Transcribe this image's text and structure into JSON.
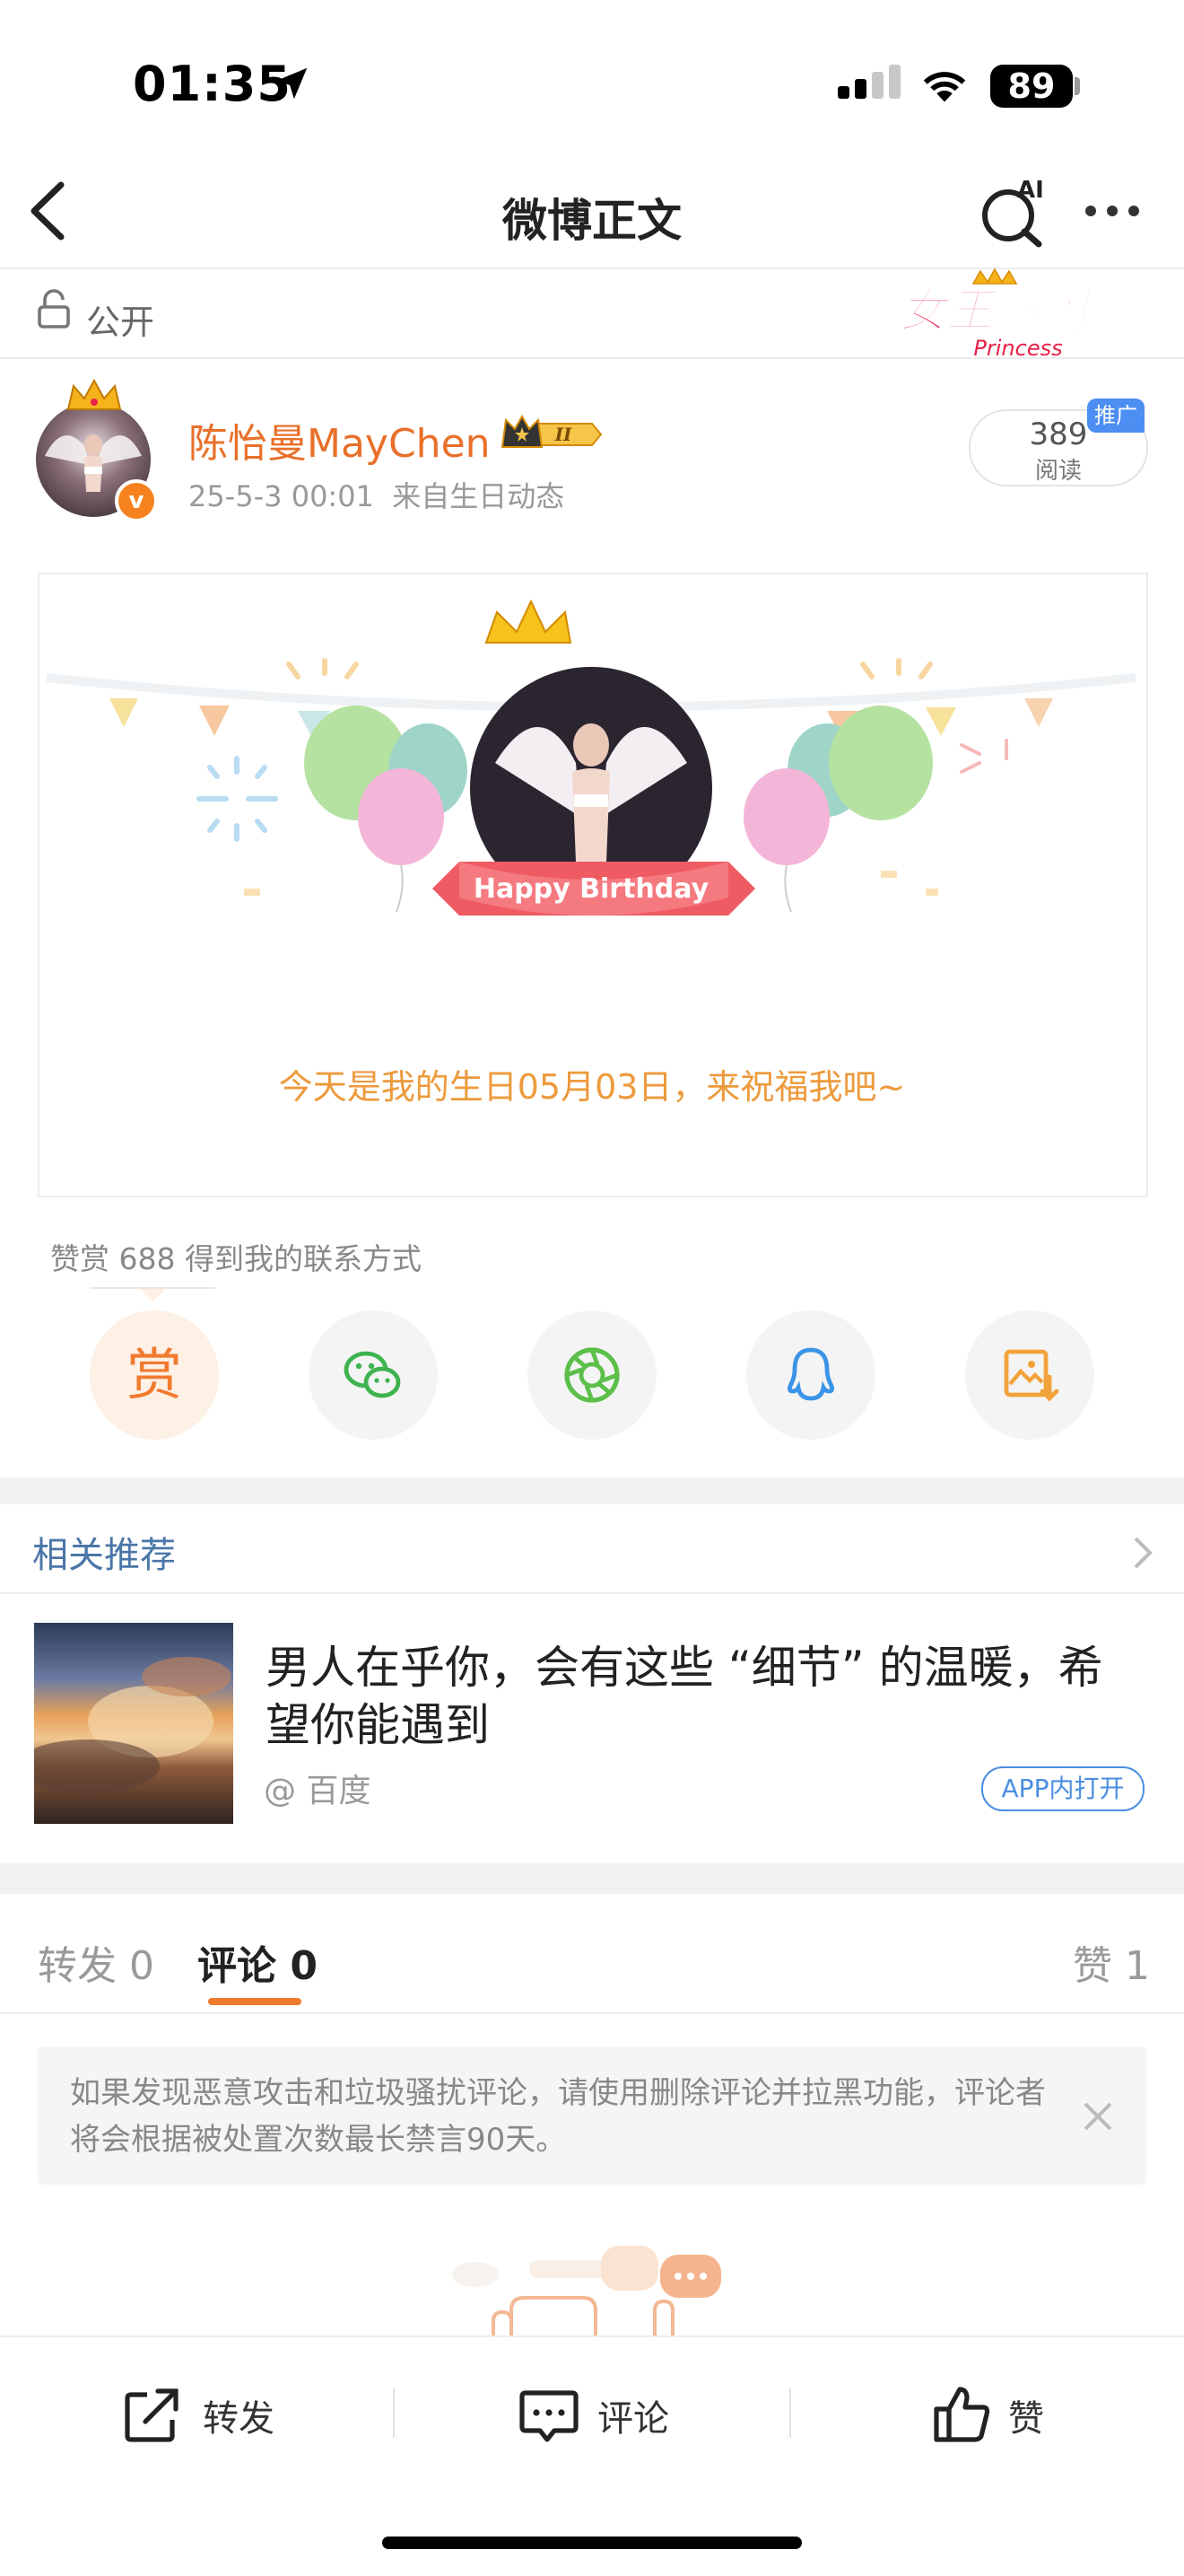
{
  "status": {
    "time": "01:35",
    "battery": "89"
  },
  "nav": {
    "title": "微博正文",
    "ai_label": "AI"
  },
  "visibility": {
    "label": "公开"
  },
  "badge": {
    "signin_text": "女王驾到",
    "signin_sub": "Princess"
  },
  "author": {
    "name": "陈怡曼MayChen",
    "vip_level": "II",
    "timestamp": "25-5-3 00:01",
    "source": "来自生日动态"
  },
  "reads": {
    "count": "389",
    "label": "阅读",
    "promo_tag": "推广"
  },
  "birthday": {
    "banner": "Happy Birthday",
    "message": "今天是我的生日05月03日，来祝福我吧~"
  },
  "reward_tip": "赞赏 688 得到我的联系方式",
  "share": {
    "reward_char": "赏"
  },
  "related": {
    "title": "相关推荐",
    "headline": "男人在乎你，会有这些 “细节” 的温暖，希望你能遇到",
    "source": "@ 百度",
    "open_app": "APP内打开"
  },
  "tabs": {
    "repost": "转发 0",
    "comment": "评论 0",
    "like": "赞 1"
  },
  "notice": "如果发现恶意攻击和垃圾骚扰评论，请使用删除评论并拉黑功能，评论者将会根据被处置次数最长禁言90天。",
  "toolbar": {
    "repost": "转发",
    "comment": "评论",
    "like": "赞"
  },
  "colors": {
    "accent": "#f07a2e",
    "link": "#4a76a8",
    "name": "#e8702a"
  }
}
